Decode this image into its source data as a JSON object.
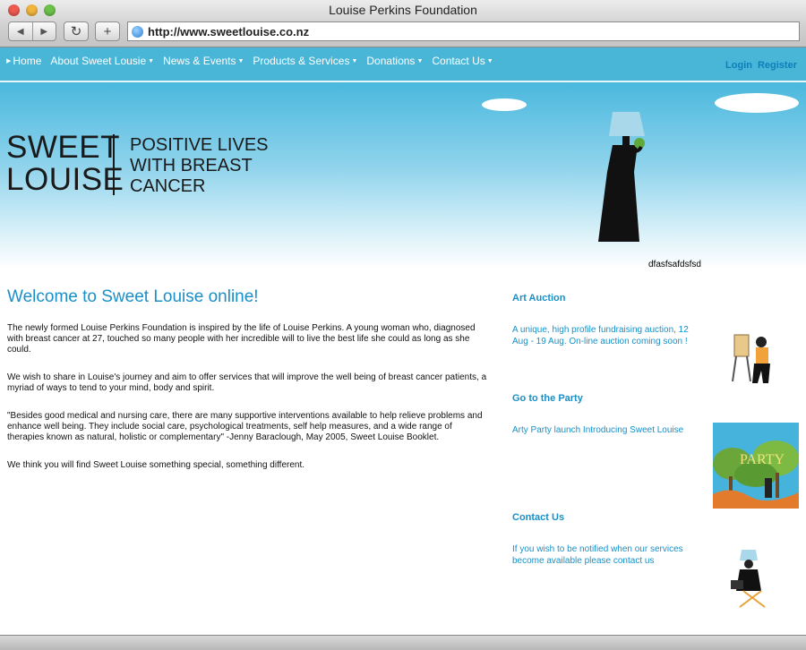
{
  "window": {
    "title": "Louise Perkins Foundation",
    "url": "http://www.sweetlouise.co.nz",
    "back_label": "◀",
    "forward_label": "▶",
    "reload_label": "↻",
    "add_label": "+"
  },
  "nav": {
    "home": "Home",
    "about": "About Sweet Lousie",
    "news": "News & Events",
    "products": "Products & Services",
    "donations": "Donations",
    "contact": "Contact Us",
    "login": "Login",
    "register": "Register"
  },
  "hero": {
    "logo_line1": "SWEET",
    "logo_line2": "LOUISE",
    "tag_line1": "POSITIVE LIVES",
    "tag_line2": "WITH BREAST",
    "tag_line3": "CANCER",
    "caption": "dfasfsafdsfsd"
  },
  "main": {
    "heading": "Welcome to Sweet Louise online!",
    "p1": "The newly formed Louise Perkins Foundation is inspired by the life of Louise Perkins.  A young woman who, diagnosed with breast cancer at 27, touched so many people with her incredible will to live the best life she could as long as she could.",
    "p2": "We wish to share in Louise's journey and aim to offer services that will improve the well being of breast cancer patients, a myriad of ways to tend to your mind, body and spirit.",
    "p3": "\"Besides good medical and nursing care, there are many supportive interventions available to help relieve problems and enhance well being.  They include social care, psychological treatments, self help measures, and a wide range of therapies known as natural, holistic or complementary\"  -Jenny Baraclough, May 2005, Sweet Louise Booklet.",
    "p4": "We think you will find Sweet Louise something special, something different."
  },
  "sidebar": {
    "auction_heading": "Art Auction",
    "auction_text": "A unique, high profile fundraising auction, 12 Aug - 19 Aug. On-line auction coming soon !",
    "party_heading": "Go to the Party",
    "party_text": "Arty Party launch Introducing Sweet Louise",
    "party_image_text": "PARTY",
    "contact_heading": "Contact Us",
    "contact_text": "If you wish to be notified when our services become available please contact us"
  },
  "colors": {
    "nav_bg": "#49b6d8",
    "link": "#1790c8",
    "heading": "#1a8fc8"
  }
}
